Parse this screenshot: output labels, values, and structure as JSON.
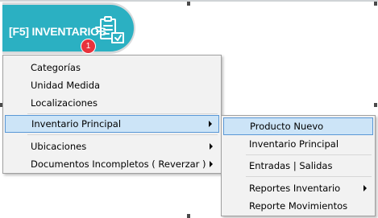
{
  "module": {
    "label": "[F5] INVENTARIOS",
    "badge_count": "1",
    "accent_color": "#2bb0c2",
    "icon": "inventory-clipboard-icon"
  },
  "main_menu": {
    "items": [
      {
        "label": "Categorías",
        "has_submenu": false
      },
      {
        "label": "Unidad Medida",
        "has_submenu": false
      },
      {
        "label": "Localizaciones",
        "has_submenu": false
      },
      {
        "label": "Inventario Principal",
        "has_submenu": true,
        "highlighted": true
      },
      {
        "label": "Ubicaciones",
        "has_submenu": true
      },
      {
        "label": "Documentos Incompletos ( Reverzar )",
        "has_submenu": true
      }
    ]
  },
  "sub_menu": {
    "items": [
      {
        "label": "Producto Nuevo",
        "has_submenu": false,
        "highlighted": true
      },
      {
        "label": "Inventario Principal",
        "has_submenu": false
      },
      {
        "label": "Entradas | Salidas",
        "has_submenu": false
      },
      {
        "label": "Reportes Inventario",
        "has_submenu": true
      },
      {
        "label": "Reporte Movimientos",
        "has_submenu": false
      }
    ]
  }
}
